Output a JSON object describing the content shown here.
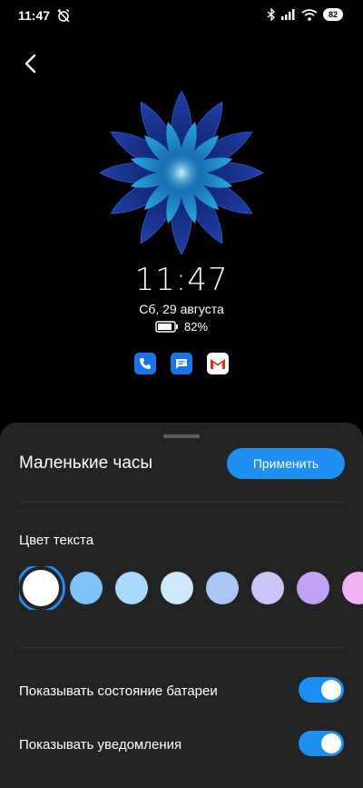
{
  "status_bar": {
    "time": "11:47",
    "battery": "82",
    "icons": [
      "alarm-off-icon",
      "bluetooth-icon",
      "signal-icon",
      "wifi-icon",
      "battery-icon"
    ]
  },
  "preview": {
    "time": "11:47",
    "date": "Сб, 29 августа",
    "battery_percent": "82%",
    "notification_apps": [
      "phone-icon",
      "messages-icon",
      "gmail-icon"
    ]
  },
  "sheet": {
    "title": "Маленькие часы",
    "apply_label": "Применить",
    "text_color_label": "Цвет текста",
    "colors": [
      "#ffffff",
      "#7ec4f9",
      "#a9dafb",
      "#cde8fb",
      "#aac6f7",
      "#c9c6f7",
      "#c2a2f4",
      "#f0b4f4"
    ],
    "selected_color": "#ffffff",
    "toggles": [
      {
        "label": "Показывать состояние батареи",
        "on": true
      },
      {
        "label": "Показывать уведомления",
        "on": true
      }
    ]
  },
  "colors": {
    "accent": "#1d8ff0",
    "sheet_bg": "#232323"
  }
}
